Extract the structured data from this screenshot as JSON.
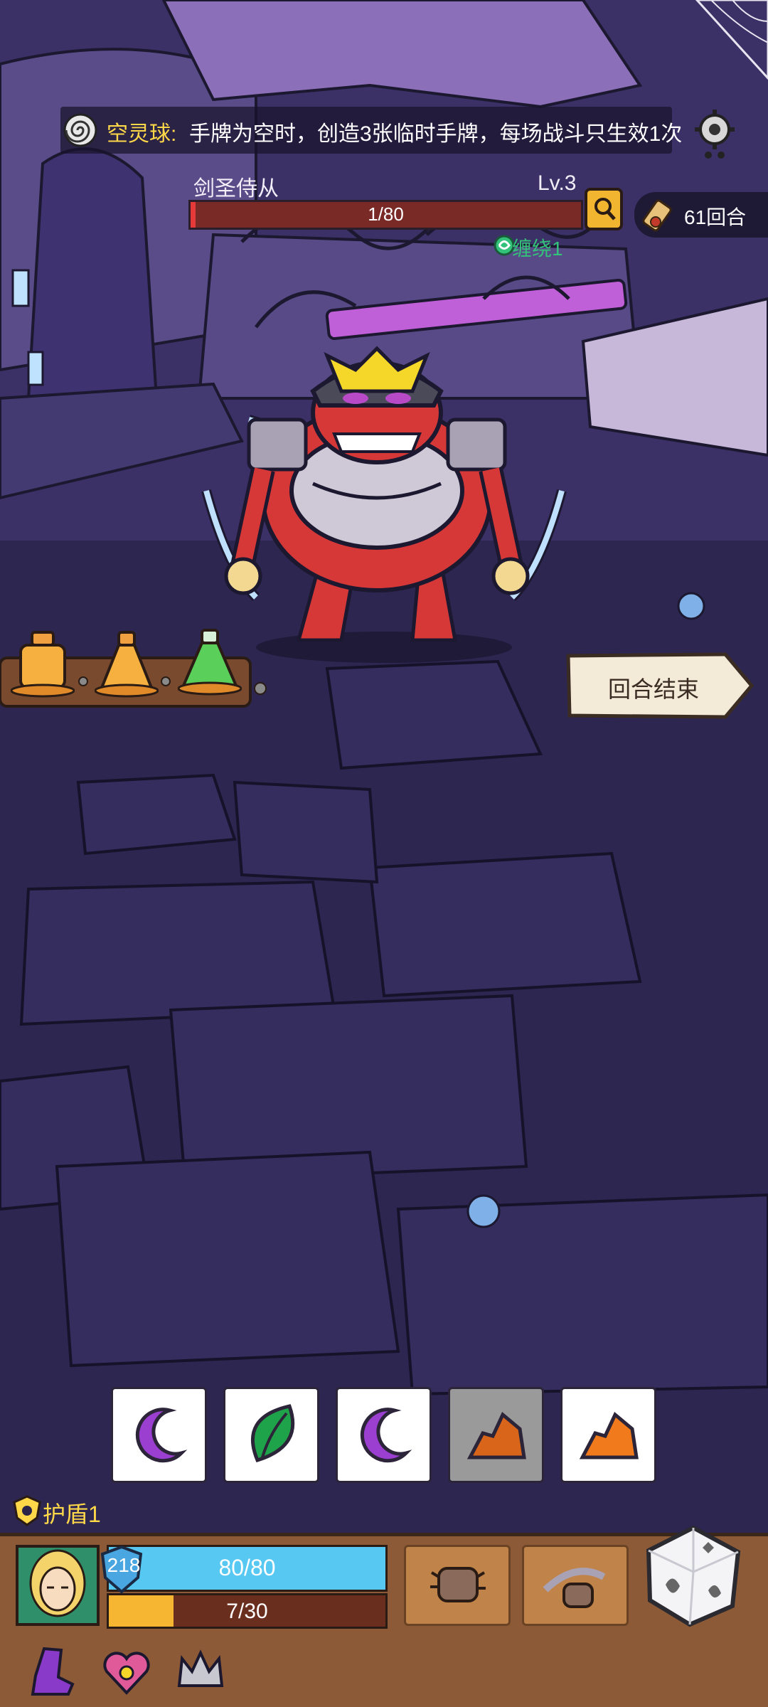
{
  "relic": {
    "icon": "spiral-orb-icon",
    "name": "空灵球:",
    "description": "手牌为空时，创造3张临时手牌，每场战斗只生效1次"
  },
  "settings": {
    "icon": "gear-icon"
  },
  "enemy": {
    "name": "剑圣侍从",
    "level": "Lv.3",
    "hp_text": "1/80",
    "hp_fraction": 0.0125,
    "status": "缠绕1",
    "inspect_icon": "magnifier-icon"
  },
  "turn": {
    "icon": "scroll-icon",
    "label": "61回合"
  },
  "potions": [
    "orange-potion",
    "orange-potion",
    "green-potion"
  ],
  "end_turn": {
    "label": "回合结束"
  },
  "dice_cards": [
    {
      "icon": "purple-moon-icon",
      "color": "#9a3fd0",
      "disabled": false
    },
    {
      "icon": "green-leaf-icon",
      "color": "#1fa34a",
      "disabled": false
    },
    {
      "icon": "purple-moon-icon",
      "color": "#9a3fd0",
      "disabled": false
    },
    {
      "icon": "orange-rock-icon",
      "color": "#e5731e",
      "disabled": true
    },
    {
      "icon": "orange-rock-icon",
      "color": "#f07a1c",
      "disabled": false
    }
  ],
  "shield": {
    "label": "护盾1",
    "icon": "shield-icon"
  },
  "player": {
    "armor": "218",
    "hp": "80/80",
    "hp_fraction": 1.0,
    "energy": "7/30",
    "energy_fraction": 0.233
  },
  "skills": [
    {
      "icon": "spiked-fist-icon"
    },
    {
      "icon": "dash-punch-icon"
    }
  ],
  "dice_button": {
    "icon": "dice-icon"
  },
  "relics_bar": [
    {
      "icon": "purple-boot-icon"
    },
    {
      "icon": "heart-amulet-icon"
    },
    {
      "icon": "iron-crown-icon"
    }
  ],
  "colors": {
    "enemy_hp": "#e63a3a",
    "player_hp": "#56c8f2",
    "energy": "#f7b631",
    "status_green": "#33c27a",
    "highlight_yellow": "#ffd84a"
  }
}
